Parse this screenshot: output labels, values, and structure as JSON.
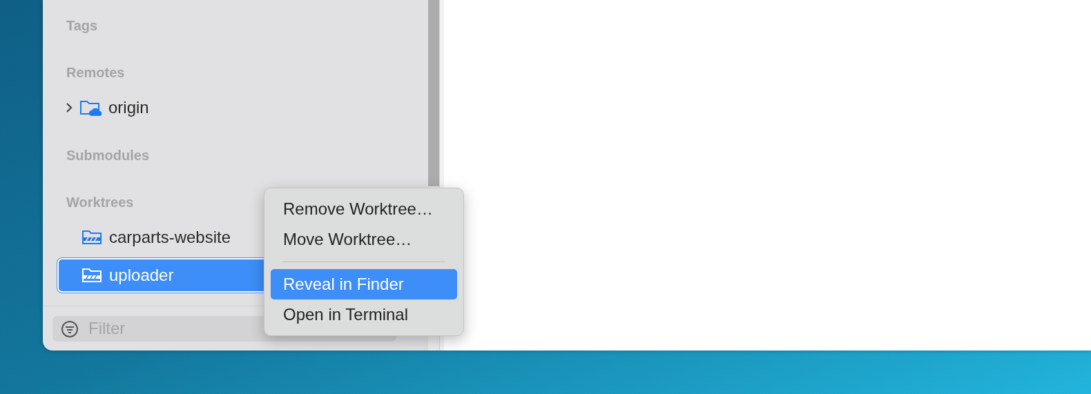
{
  "sidebar": {
    "sections": [
      {
        "title": "Tags"
      },
      {
        "title": "Remotes",
        "items": [
          {
            "label": "origin",
            "kind": "remote",
            "expanded": false,
            "selected": false
          }
        ]
      },
      {
        "title": "Submodules"
      },
      {
        "title": "Worktrees",
        "items": [
          {
            "label": "carparts-website",
            "kind": "worktree",
            "selected": false
          },
          {
            "label": "uploader",
            "kind": "worktree",
            "selected": true
          }
        ]
      }
    ],
    "filter": {
      "placeholder": "Filter"
    }
  },
  "context_menu": {
    "items": [
      {
        "kind": "item",
        "label": "Remove Worktree…",
        "selected": false
      },
      {
        "kind": "item",
        "label": "Move Worktree…",
        "selected": false
      },
      {
        "kind": "separator"
      },
      {
        "kind": "item",
        "label": "Reveal in Finder",
        "selected": true
      },
      {
        "kind": "item",
        "label": "Open in Terminal",
        "selected": false
      }
    ]
  }
}
